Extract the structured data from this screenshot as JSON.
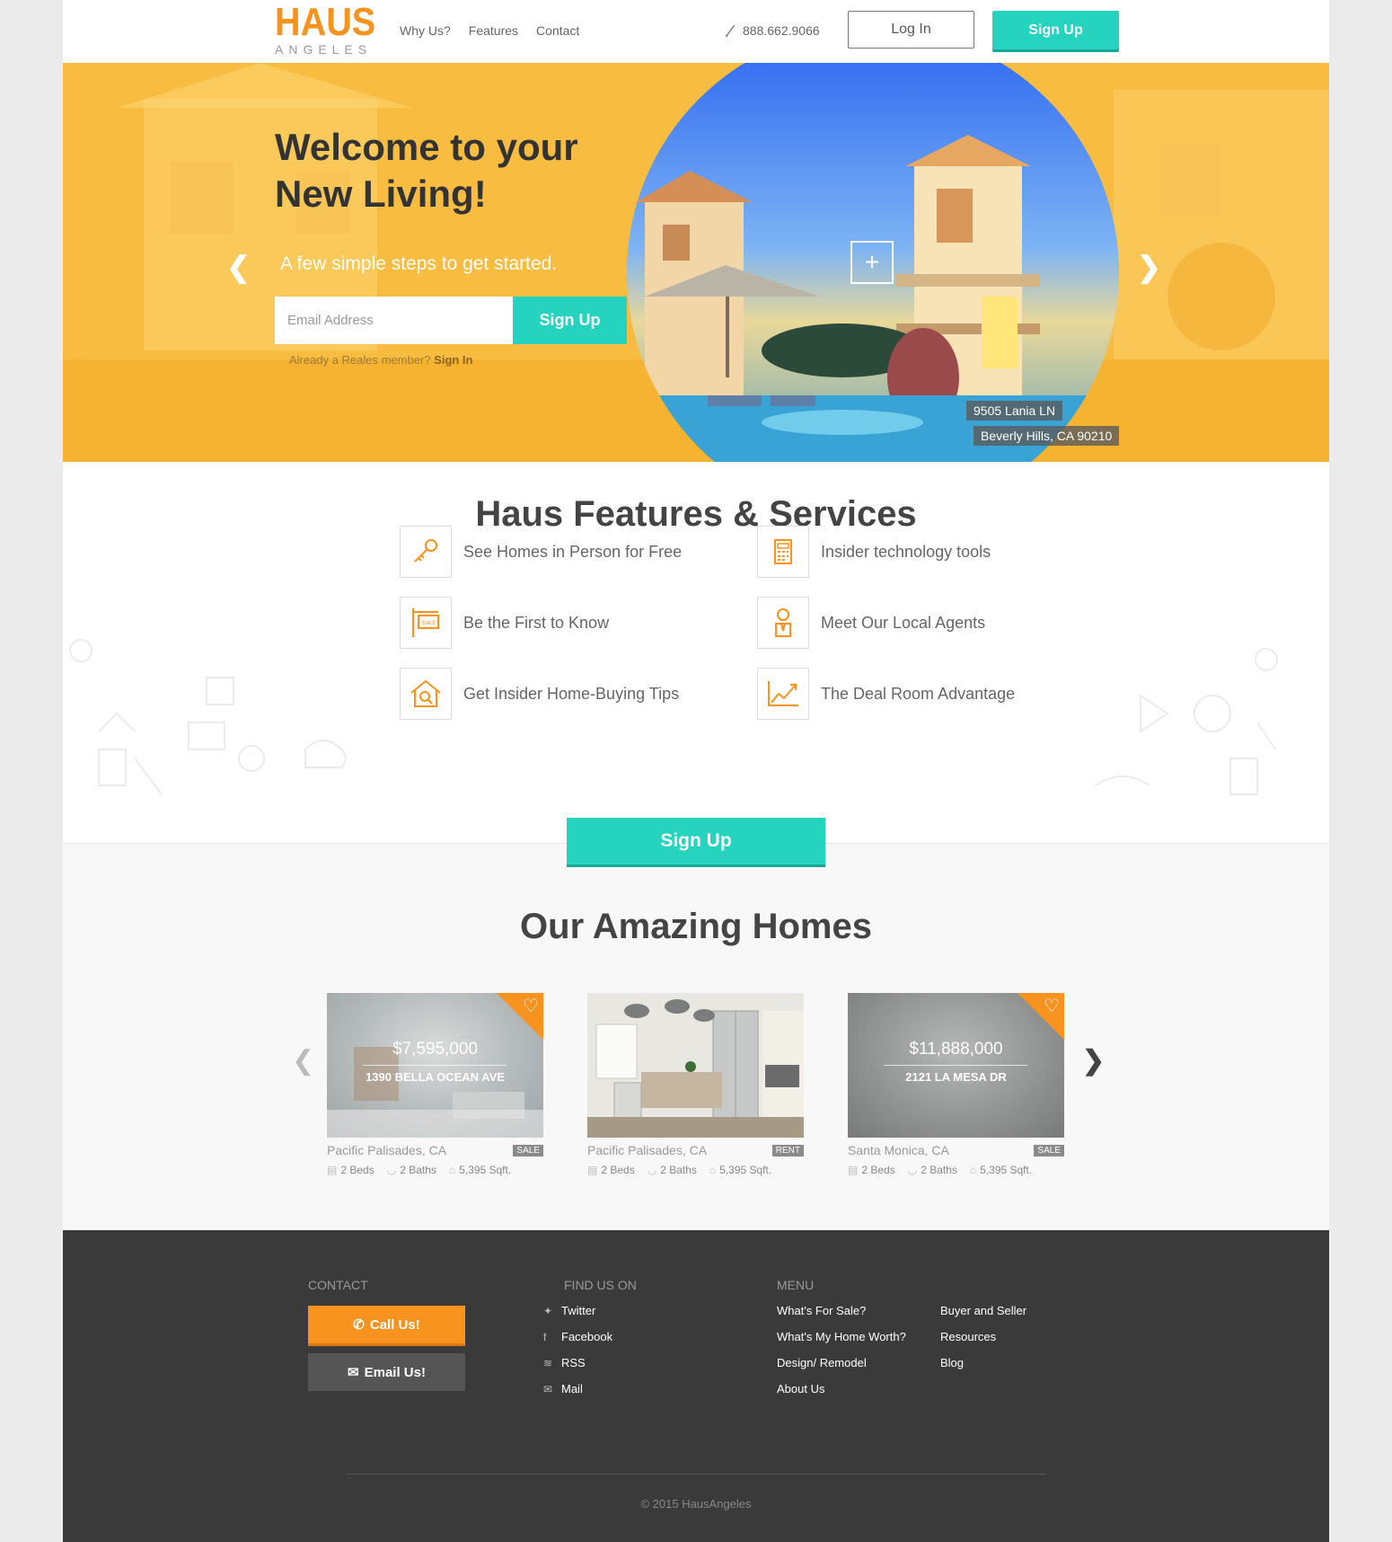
{
  "brand": {
    "name": "HAUS",
    "sub": "ANGELES"
  },
  "nav": {
    "items": [
      "Why Us?",
      "Features",
      "Contact"
    ]
  },
  "header": {
    "phone": "888.662.9066",
    "login_label": "Log In",
    "signup_label": "Sign Up"
  },
  "hero": {
    "title_line1": "Welcome to your",
    "title_line2": "New Living!",
    "subtitle": "A few simple steps to get started.",
    "email_placeholder": "Email Address",
    "signup_label": "Sign Up",
    "member_text": "Already a Reales member?",
    "member_link": "Sign In",
    "address_line1": "9505 Lania LN",
    "address_line2": "Beverly Hills, CA 90210"
  },
  "features": {
    "title": "Haus Features & Services",
    "items": [
      {
        "label": "See Homes in Person for Free",
        "icon": "key-icon"
      },
      {
        "label": "Insider technology tools",
        "icon": "calculator-icon"
      },
      {
        "label": "Be the First to Know",
        "icon": "sale-sign-icon"
      },
      {
        "label": "Meet Our Local Agents",
        "icon": "agent-icon"
      },
      {
        "label": "Get Insider Home-Buying Tips",
        "icon": "house-search-icon"
      },
      {
        "label": "The Deal Room Advantage",
        "icon": "chart-up-icon"
      }
    ],
    "signup_label": "Sign Up"
  },
  "homes": {
    "title": "Our Amazing Homes",
    "cards": [
      {
        "price": "$7,595,000",
        "address": "1390 BELLA OCEAN AVE",
        "location": "Pacific Palisades, CA",
        "badge": "SALE",
        "beds": "2 Beds",
        "baths": "2 Baths",
        "sqft": "5,395 Sqft.",
        "favorite": true,
        "color_a": "#b9bec0",
        "color_b": "#d6d8d6"
      },
      {
        "price": "",
        "address": "",
        "location": "Pacific Palisades, CA",
        "badge": "RENT",
        "beds": "2 Beds",
        "baths": "2 Baths",
        "sqft": "5,395 Sqft.",
        "favorite": false,
        "color_a": "#e6e4df",
        "color_b": "#bdb8ad"
      },
      {
        "price": "$11,888,000",
        "address": "2121 LA MESA DR",
        "location": "Santa Monica, CA",
        "badge": "SALE",
        "beds": "2 Beds",
        "baths": "2 Baths",
        "sqft": "5,395 Sqft.",
        "favorite": true,
        "color_a": "#8e9190",
        "color_b": "#b2b4b3"
      }
    ]
  },
  "footer": {
    "contact_head": "CONTACT",
    "call_label": "Call Us!",
    "email_label": "Email Us!",
    "find_head": "FIND US ON",
    "social": [
      {
        "label": "Twitter",
        "icon": "twitter-icon"
      },
      {
        "label": "Facebook",
        "icon": "facebook-icon"
      },
      {
        "label": "RSS",
        "icon": "rss-icon"
      },
      {
        "label": "Mail",
        "icon": "mail-icon"
      }
    ],
    "menu_head": "MENU",
    "menu_col1": [
      "What's For Sale?",
      "What's My Home Worth?",
      "Design/ Remodel",
      "About Us"
    ],
    "menu_col2": [
      "Buyer and Seller",
      "Resources",
      "Blog"
    ],
    "copyright": "© 2015 HausAngeles"
  },
  "colors": {
    "accent": "#26d3be",
    "brand": "#f7931e",
    "footer_bg": "#3a3a3a",
    "hero": "#f7b838"
  }
}
